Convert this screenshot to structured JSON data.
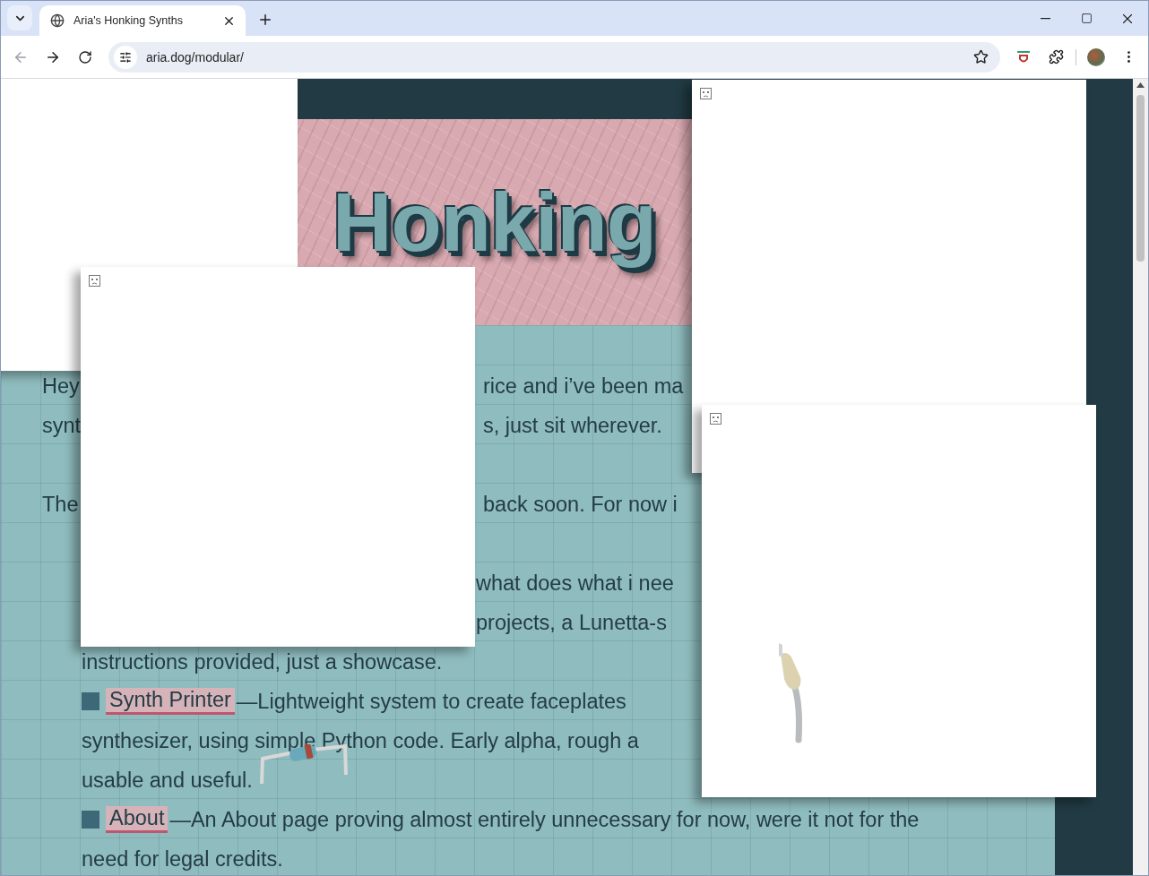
{
  "browser": {
    "tab": {
      "title": "Aria's Honking Synths",
      "selected": true
    },
    "back_disabled": true,
    "address": "aria.dog/modular/"
  },
  "page": {
    "banner_title": "Honking",
    "lines": [
      {
        "kind": "split",
        "left": "Hey",
        "right": "rice and i’ve been ma"
      },
      {
        "kind": "split",
        "left": "synt",
        "right": "s, just sit wherever."
      },
      {
        "kind": "blank"
      },
      {
        "kind": "split",
        "left": "The",
        "right": "back soon. For now i"
      },
      {
        "kind": "blank"
      },
      {
        "kind": "right",
        "text": "what does what i nee"
      },
      {
        "kind": "right",
        "text": "projects, a Lunetta-s"
      },
      {
        "kind": "item",
        "text": "instructions provided, just a showcase."
      },
      {
        "kind": "bullet",
        "link": "Synth Printer",
        "text": "—Lightweight system to create faceplates"
      },
      {
        "kind": "item",
        "text": "synthesizer, using simple Python code. Early alpha, rough a"
      },
      {
        "kind": "item",
        "text": "usable and useful."
      },
      {
        "kind": "bullet",
        "link": "About",
        "text": "—An About page proving almost entirely unnecessary for now, were it not for the"
      },
      {
        "kind": "item",
        "text": "need for legal credits."
      }
    ],
    "images": [
      {
        "kind": "plain"
      },
      {
        "kind": "broken"
      },
      {
        "kind": "broken"
      },
      {
        "kind": "broken_cable"
      }
    ]
  }
}
